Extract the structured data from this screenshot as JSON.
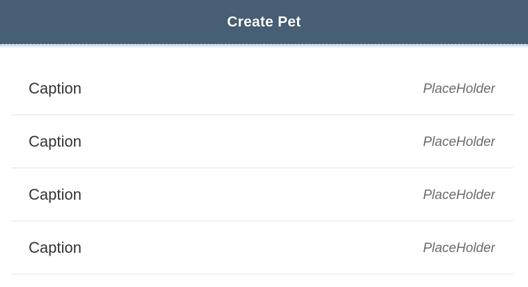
{
  "header": {
    "title": "Create Pet",
    "background_color": "#475f75"
  },
  "form": {
    "rows": [
      {
        "caption": "Caption",
        "placeholder": "PlaceHolder"
      },
      {
        "caption": "Caption",
        "placeholder": "PlaceHolder"
      },
      {
        "caption": "Caption",
        "placeholder": "PlaceHolder"
      },
      {
        "caption": "Caption",
        "placeholder": "PlaceHolder"
      }
    ]
  }
}
